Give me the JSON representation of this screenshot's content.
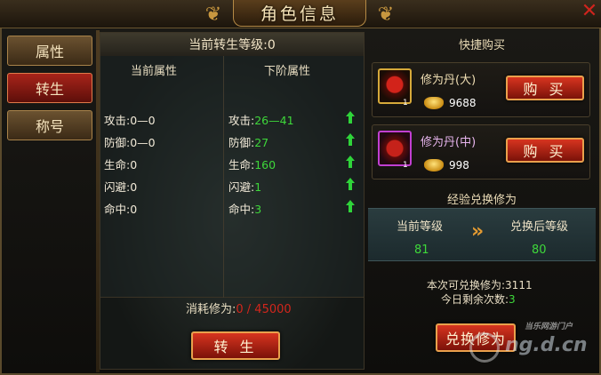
{
  "window": {
    "title": "角色信息"
  },
  "tabs": [
    {
      "label": "属性",
      "active": false
    },
    {
      "label": "转生",
      "active": true
    },
    {
      "label": "称号",
      "active": false
    }
  ],
  "rebirth": {
    "current_level_text": "当前转生等级:0",
    "col_current": "当前属性",
    "col_next": "下阶属性",
    "stats": [
      {
        "current": "攻击:0—0",
        "next_label": "攻击:",
        "next_value": "26—41"
      },
      {
        "current": "防御:0—0",
        "next_label": "防御:",
        "next_value": "27"
      },
      {
        "current": "生命:0",
        "next_label": "生命:",
        "next_value": "160"
      },
      {
        "current": "闪避:0",
        "next_label": "闪避:",
        "next_value": "1"
      },
      {
        "current": "命中:0",
        "next_label": "命中:",
        "next_value": "3"
      }
    ],
    "cost_label": "消耗修为:",
    "cost_value": "0 / 45000",
    "button_label": "转 生"
  },
  "quick_buy": {
    "title": "快捷购买",
    "items": [
      {
        "name": "修为丹(大)",
        "count": "1",
        "price": "9688",
        "button": "购 买",
        "rarity_color": "#d6a93a"
      },
      {
        "name": "修为丹(中)",
        "count": "1",
        "price": "998",
        "button": "购 买",
        "rarity_color": "#c13fd1"
      }
    ]
  },
  "exchange": {
    "title": "经验兑换修为",
    "current_level_label": "当前等级",
    "after_level_label": "兑换后等级",
    "current_level": "81",
    "after_level": "80",
    "convertible_label": "本次可兑换修为:",
    "convertible_value": "3111",
    "remaining_label": "今日剩余次数:",
    "remaining_value": "3",
    "button_label": "兑换修为"
  },
  "watermark": {
    "small": "当乐网游门户",
    "big": "ng.d.cn"
  },
  "colors": {
    "accent_red": "#d3261c",
    "stat_green": "#3ed83a",
    "gold": "#d6a93a"
  }
}
